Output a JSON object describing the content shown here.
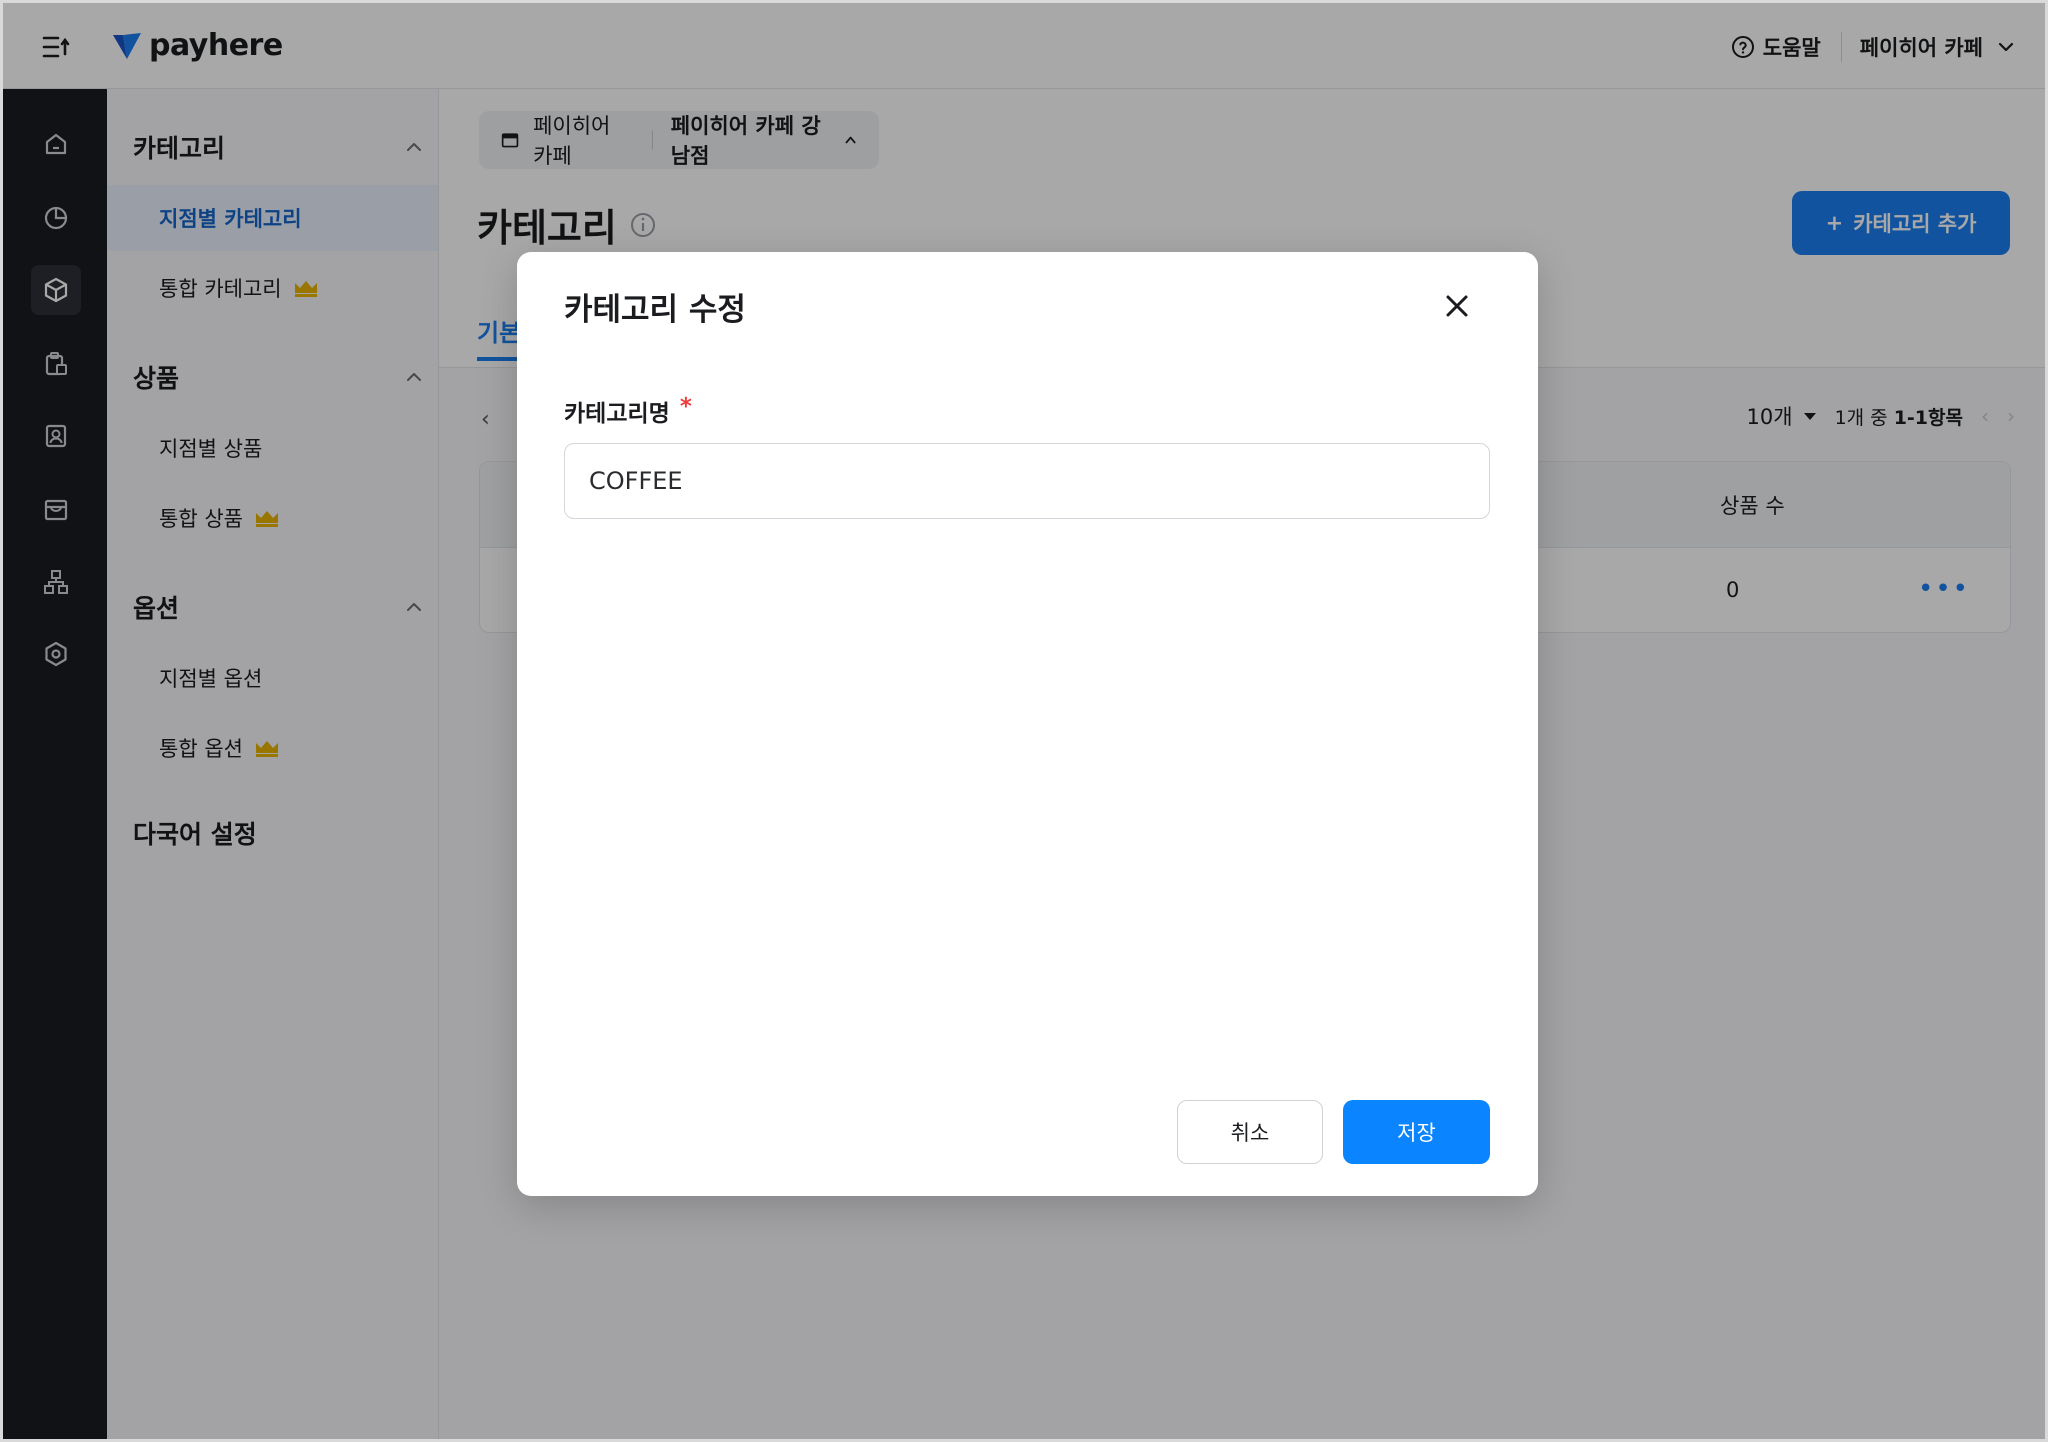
{
  "brand": {
    "name": "payhere",
    "accent": "#1a7ef0"
  },
  "topbar": {
    "help_label": "도움말",
    "store_label": "페이히어 카페"
  },
  "rail": {
    "icons": [
      "home-icon",
      "chart-pie-icon",
      "box-icon",
      "clipboard-icon",
      "contact-icon",
      "store-icon",
      "org-chart-icon",
      "settings-icon"
    ]
  },
  "subnav": {
    "groups": [
      {
        "title": "카테고리",
        "items": [
          {
            "label": "지점별 카테고리",
            "active": true
          },
          {
            "label": "통합 카테고리",
            "premium": true
          }
        ]
      },
      {
        "title": "상품",
        "items": [
          {
            "label": "지점별 상품"
          },
          {
            "label": "통합 상품",
            "premium": true
          }
        ]
      },
      {
        "title": "옵션",
        "items": [
          {
            "label": "지점별 옵션"
          },
          {
            "label": "통합 옵션",
            "premium": true
          }
        ]
      },
      {
        "title": "다국어 설정",
        "items": []
      }
    ]
  },
  "main": {
    "branch": {
      "brand": "페이히어 카페",
      "branch": "페이히어 카페 강남점"
    },
    "title": "카테고리",
    "add_button": "카테고리 추가",
    "tab_basic": "기본",
    "pager": {
      "size": "10개",
      "info_prefix": "1개 중",
      "info_range": "1-1항목"
    },
    "table": {
      "col_product_count": "상품 수",
      "rows": [
        {
          "product_count": "0"
        }
      ]
    }
  },
  "modal": {
    "title": "카테고리 수정",
    "field_label": "카테고리명",
    "required_mark": "*",
    "field_value": "COFFEE",
    "cancel_label": "취소",
    "save_label": "저장"
  }
}
